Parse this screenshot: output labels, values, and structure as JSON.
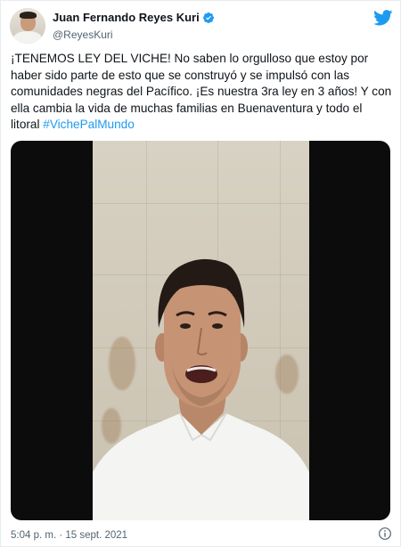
{
  "author": {
    "display_name": "Juan Fernando Reyes Kuri",
    "handle": "@ReyesKuri",
    "verified": true,
    "avatar_icon": "profile-photo"
  },
  "tweet": {
    "text": "¡TENEMOS LEY DEL VICHE! No saben lo orgulloso que estoy por haber sido parte de esto que se construyó y se impulsó con las comunidades negras del Pacífico. ¡Es nuestra 3ra ley en 3 años! Y con ella cambia la vida de muchas familias en Buenaventura y todo el litoral ",
    "hashtag": "#VichePalMundo",
    "timestamp": "5:04 p. m. · 15 sept. 2021"
  },
  "icons": {
    "brand": "twitter-bird-icon",
    "verified": "verified-badge-icon",
    "info": "info-icon"
  },
  "colors": {
    "accent": "#1d9bf0",
    "text": "#0f1419",
    "secondary": "#536471",
    "media_background": "#0c0c0c"
  }
}
